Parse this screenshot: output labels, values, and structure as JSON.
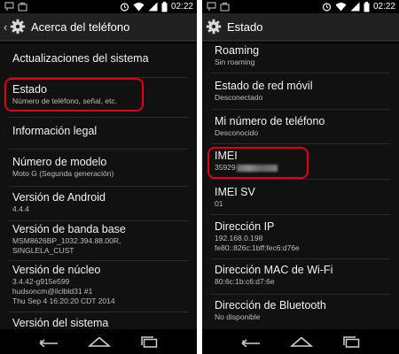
{
  "status_bar": {
    "time": "02:22"
  },
  "left": {
    "title": "Acerca del teléfono",
    "items": [
      {
        "title": "Actualizaciones del sistema",
        "subtitle": ""
      },
      {
        "title": "Estado",
        "subtitle": "Número de teléfono, señal, etc."
      },
      {
        "title": "Información legal",
        "subtitle": ""
      },
      {
        "title": "Número de modelo",
        "subtitle": "Moto G (Segunda generación)"
      },
      {
        "title": "Versión de Android",
        "subtitle": "4.4.4"
      },
      {
        "title": "Versión de banda base",
        "subtitle": "MSM8626BP_1032.394.88.00R,",
        "subtitle2": "SINGLELA_CUST"
      },
      {
        "title": "Versión de núcleo",
        "subtitle": "3.4.42-g915e599",
        "subtitle2": "hudsoncm@ilclbld31 #1",
        "subtitle3": "Thu Sep 4 16:20:20 CDT 2014"
      },
      {
        "title": "Versión del sistema",
        "subtitle": ""
      }
    ]
  },
  "right": {
    "title": "Estado",
    "items": [
      {
        "title": "Roaming",
        "subtitle": "Sin roaming"
      },
      {
        "title": "Estado de red móvil",
        "subtitle": "Desconectado"
      },
      {
        "title": "Mi número de teléfono",
        "subtitle": "Desconocido"
      },
      {
        "title": "IMEI",
        "subtitle": "35929"
      },
      {
        "title": "IMEI SV",
        "subtitle": "01"
      },
      {
        "title": "Dirección IP",
        "subtitle": "192.168.0.198",
        "subtitle2": "fe80::826c:1bff:fec6:d76e"
      },
      {
        "title": "Dirección MAC de Wi-Fi",
        "subtitle": "80:6c:1b:c6:d7:6e"
      },
      {
        "title": "Dirección de Bluetooth",
        "subtitle": "No disponible"
      }
    ]
  },
  "icons": {
    "status_left": [
      "notification-flag-icon",
      "bag-icon"
    ],
    "status_right": [
      "alarm-icon",
      "wifi-icon",
      "signal-icon",
      "battery-icon"
    ],
    "action_bar": "settings-gear-icon",
    "navigation": [
      "back-icon",
      "home-icon",
      "recent-apps-icon"
    ]
  },
  "colors": {
    "highlight": "#e3001b",
    "background": "#111111",
    "action_bar": "#212121"
  }
}
